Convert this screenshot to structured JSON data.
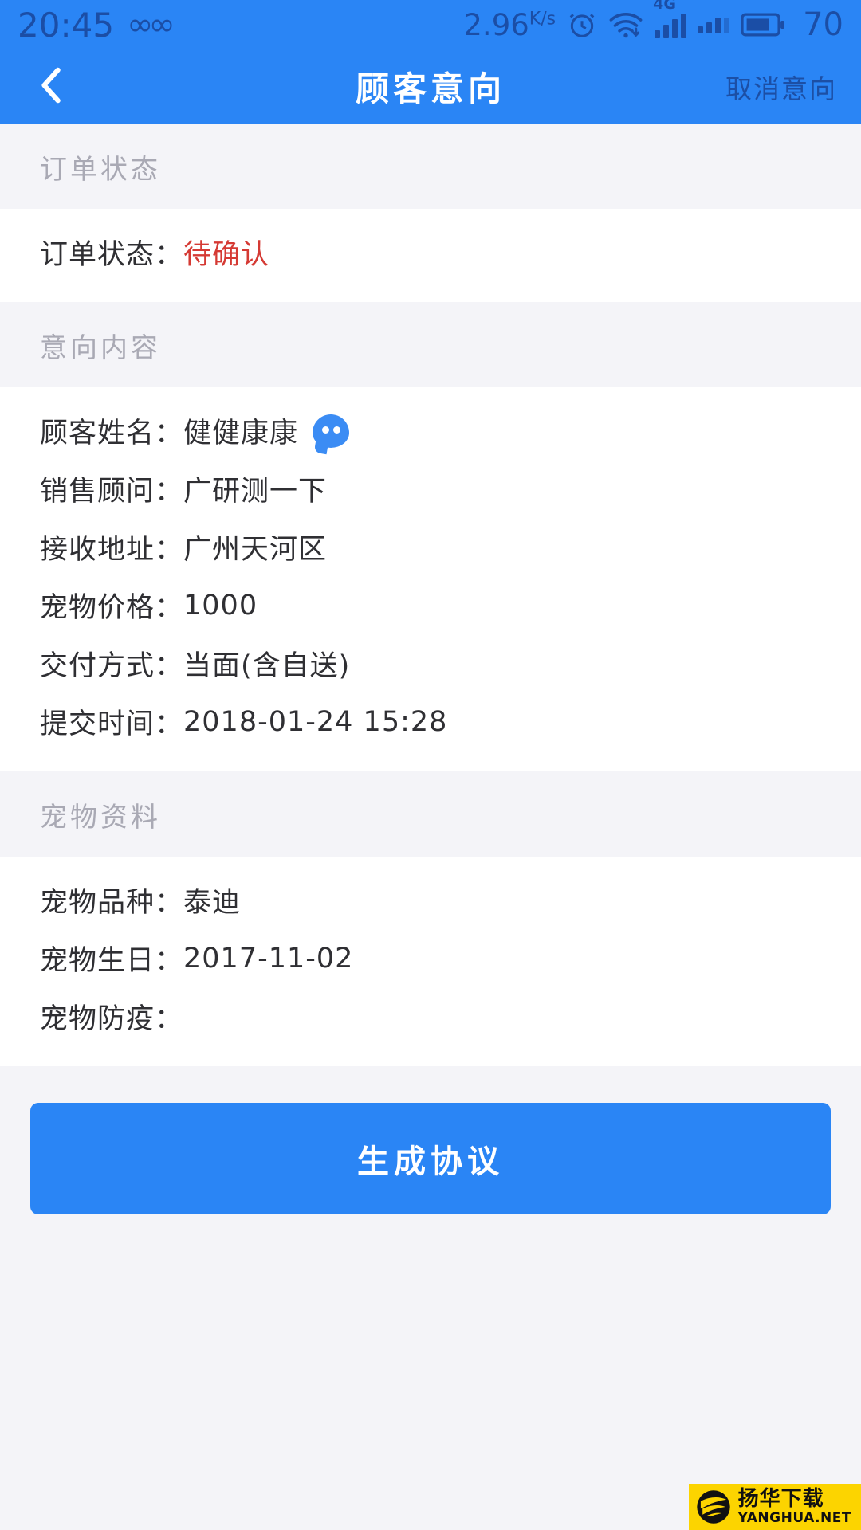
{
  "status_bar": {
    "time": "20:45",
    "infinity_icon": "infinity-icon",
    "network_speed": "2.96",
    "network_speed_unit": "K/s",
    "alarm_icon": "alarm-clock-icon",
    "wifi_icon": "wifi-icon",
    "network_type": "4G",
    "signal_icon": "signal-bars-icon",
    "signal_icon_2": "signal-bars-icon-secondary",
    "battery_icon": "battery-icon",
    "battery_level": "70"
  },
  "nav_bar": {
    "back_icon": "chevron-left-icon",
    "title": "顾客意向",
    "action_label": "取消意向"
  },
  "sections": [
    {
      "header": "订单状态",
      "rows": [
        {
          "label": "订单状态：",
          "value": "待确认",
          "status": "pending"
        }
      ]
    },
    {
      "header": "意向内容",
      "rows": [
        {
          "label": "顾客姓名：",
          "value": "健健康康",
          "icon": "chat-bubble-icon"
        },
        {
          "label": "销售顾问：",
          "value": "广研测一下"
        },
        {
          "label": "接收地址：",
          "value": "广州天河区"
        },
        {
          "label": "宠物价格：",
          "value": "1000"
        },
        {
          "label": "交付方式：",
          "value": "当面(含自送)"
        },
        {
          "label": "提交时间：",
          "value": "2018-01-24 15:28"
        }
      ]
    },
    {
      "header": "宠物资料",
      "rows": [
        {
          "label": "宠物品种：",
          "value": "泰迪"
        },
        {
          "label": "宠物生日：",
          "value": "2017-11-02"
        },
        {
          "label": "宠物防疫：",
          "value": ""
        }
      ]
    }
  ],
  "primary_button": {
    "label": "生成协议"
  },
  "watermark": {
    "cn": "扬华下载",
    "en": "YANGHUA.NET"
  },
  "colors": {
    "brand_blue": "#2a85f5",
    "nav_action_blue": "#1c4fa5",
    "status_red": "#d53a34",
    "page_bg": "#f4f4f8",
    "card_bg": "#ffffff",
    "section_header_text": "#a9a9b4",
    "watermark_yellow": "#fcd400"
  }
}
